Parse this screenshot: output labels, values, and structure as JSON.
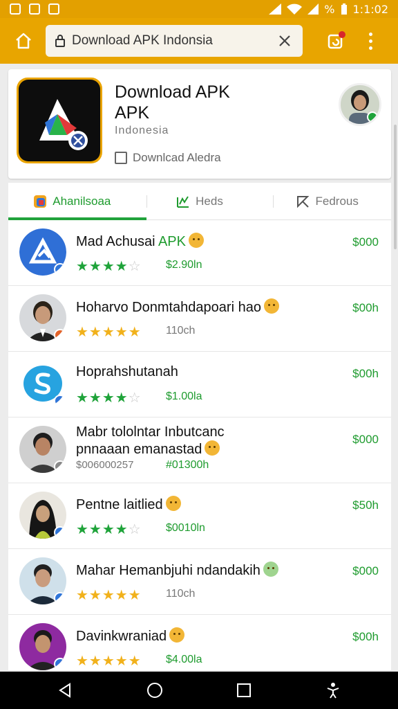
{
  "status_bar": {
    "time": "1:1:02",
    "battery_label": "%"
  },
  "toolbar": {
    "url": "Download APK Indonsia"
  },
  "app": {
    "title": "Download  APK APK",
    "subtitle": "Indonesia",
    "download_label": "Downlcad Aledra"
  },
  "tabs": [
    {
      "label": "Ahanilsoaa"
    },
    {
      "label": "Heds"
    },
    {
      "label": "Fedrous"
    }
  ],
  "rows": [
    {
      "title": "Mad Achusai ",
      "title_accent": "APK",
      "stars": 4,
      "stat": "$2.90ln",
      "price": "$000"
    },
    {
      "title": "Hoharvo Donmtahdapoari hao",
      "stars": 5,
      "stat": "110ch",
      "price": "$00h"
    },
    {
      "title": "Hoprahshutanah",
      "stars": 4,
      "stat": "$1.00la",
      "price": "$00h"
    },
    {
      "title": "Mabr tololntar  Inbutcanc",
      "title2": "pnnaaan emanastad",
      "meta": "$006000257",
      "meta2": "#01300h",
      "price": "$000"
    },
    {
      "title": "Pentne laitlied",
      "stars": 4,
      "stat": "$0010ln",
      "price": "$50h"
    },
    {
      "title": "Mahar Hemanbjuhi ndandakih",
      "stars": 5,
      "stat": "110ch",
      "price": "$000"
    },
    {
      "title": "Davinkwraniad",
      "stars": 5,
      "stat": "$4.00la",
      "price": "$00h"
    }
  ],
  "colors": {
    "brand": "#e8a500",
    "accent": "#1e9b2e",
    "star_gold": "#f1b11b"
  }
}
